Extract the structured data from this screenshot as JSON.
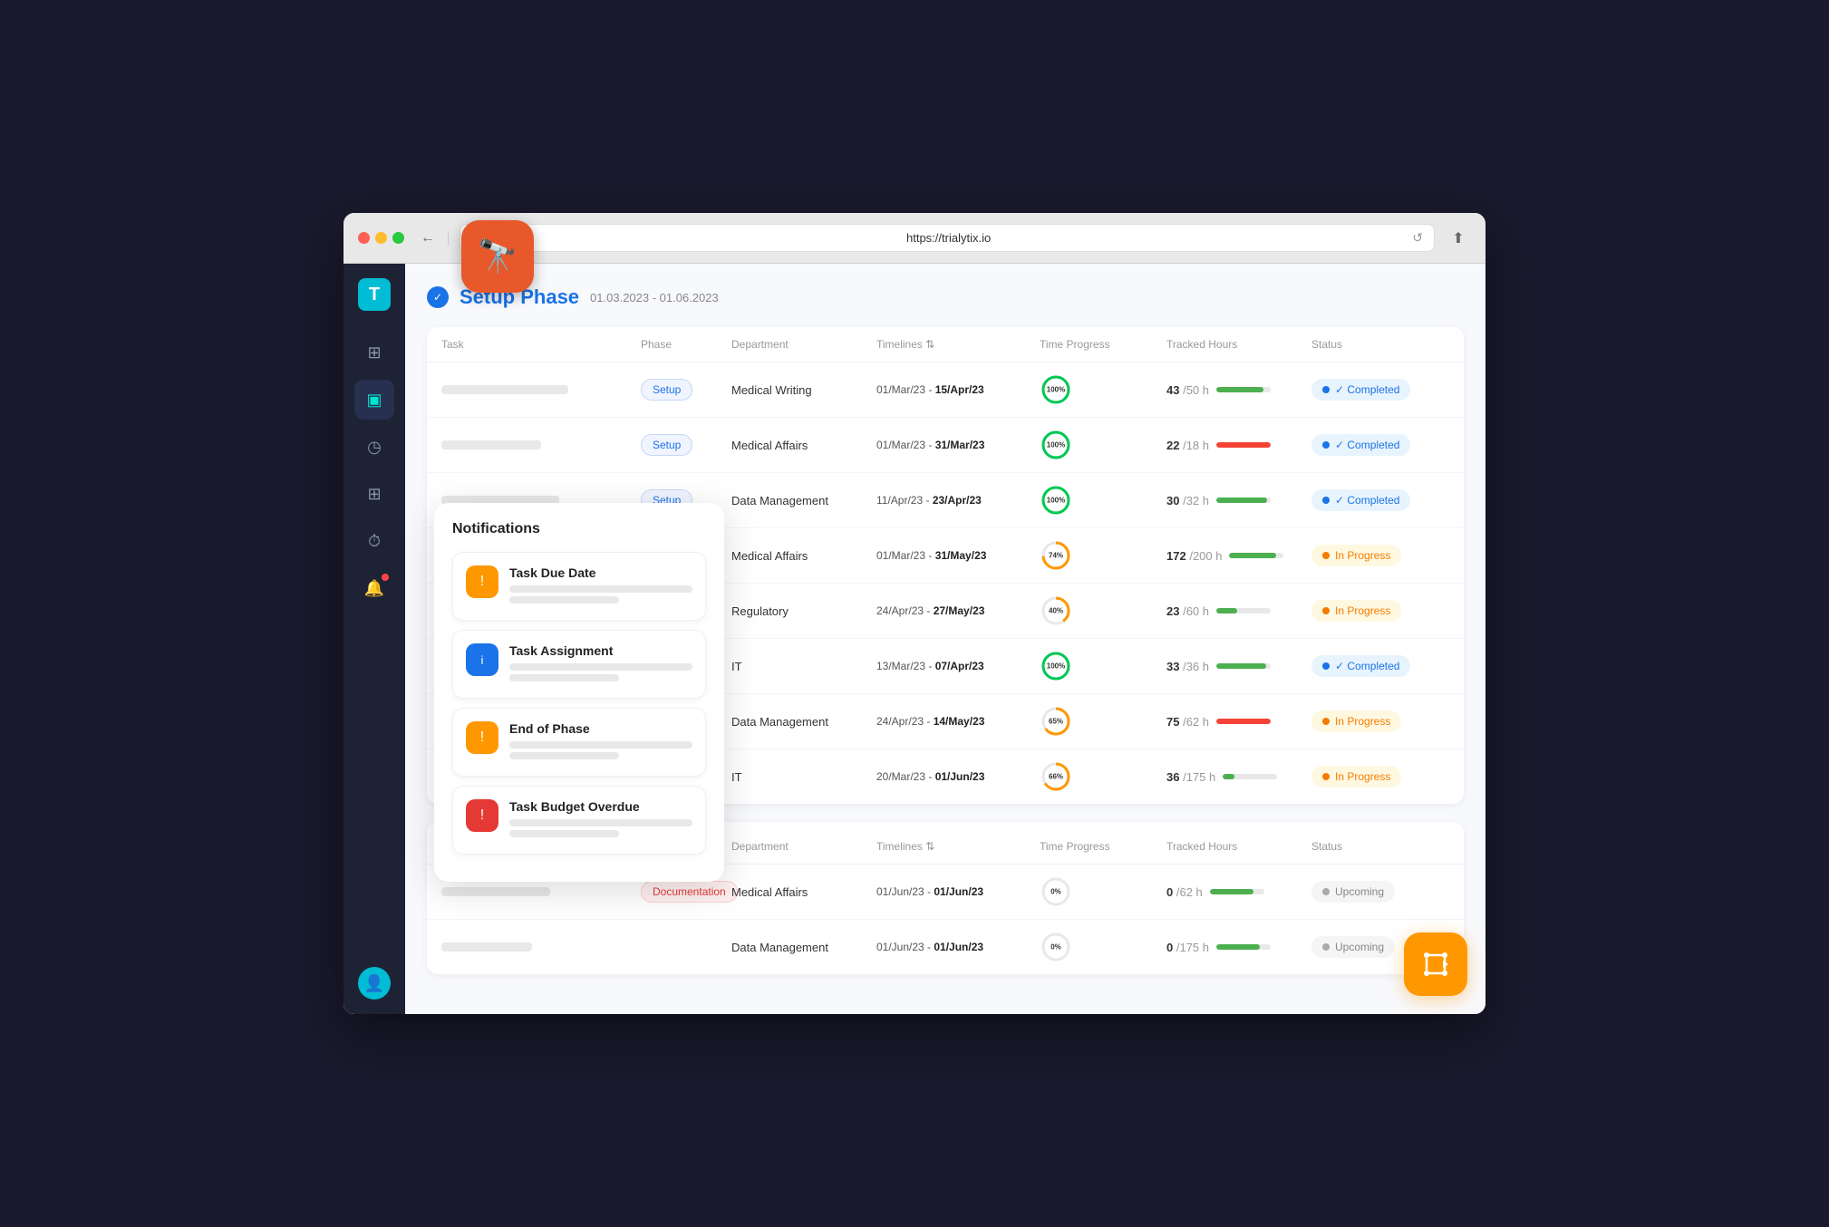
{
  "browser": {
    "url": "https://trialytix.io",
    "back_btn": "←",
    "refresh_btn": "↺",
    "share_btn": "⬆"
  },
  "sidebar": {
    "logo_letter": "T",
    "items": [
      {
        "id": "dashboard",
        "icon": "⊞",
        "active": false
      },
      {
        "id": "book",
        "icon": "▣",
        "active": true
      },
      {
        "id": "clock",
        "icon": "◷",
        "active": false
      },
      {
        "id": "grid-plus",
        "icon": "⊞",
        "active": false
      },
      {
        "id": "timer",
        "icon": "⏱",
        "active": false
      },
      {
        "id": "bell",
        "icon": "🔔",
        "active": false,
        "has_dot": true
      }
    ]
  },
  "page": {
    "phase1": {
      "title": "Setup Phase",
      "dates": "01.03.2023 - 01.06.2023",
      "columns": [
        "Task",
        "Phase",
        "Department",
        "Timelines ⇅",
        "Time Progress",
        "Tracked Hours",
        "Status"
      ],
      "rows": [
        {
          "has_placeholder": true,
          "phase_badge": "Setup",
          "phase_badge_type": "setup",
          "department": "Medical Writing",
          "timeline": "01/Mar/23",
          "timeline_end": "15/Apr/23",
          "progress_pct": 100,
          "progress_color": "#00c853",
          "hours_tracked": "43",
          "hours_total": "50 h",
          "bar_pct": 86,
          "bar_color": "green",
          "status": "Completed",
          "status_type": "completed"
        },
        {
          "has_placeholder": true,
          "phase_badge": "Setup",
          "phase_badge_type": "setup",
          "department": "Medical Affairs",
          "timeline": "01/Mar/23",
          "timeline_end": "31/Mar/23",
          "progress_pct": 100,
          "progress_color": "#00c853",
          "hours_tracked": "22",
          "hours_total": "18 h",
          "bar_pct": 100,
          "bar_color": "red",
          "status": "Completed",
          "status_type": "completed"
        },
        {
          "has_placeholder": true,
          "phase_badge": "Setup",
          "phase_badge_type": "setup",
          "department": "Data Management",
          "timeline": "11/Apr/23",
          "timeline_end": "23/Apr/23",
          "progress_pct": 100,
          "progress_color": "#00c853",
          "hours_tracked": "30",
          "hours_total": "32 h",
          "bar_pct": 94,
          "bar_color": "green",
          "status": "Completed",
          "status_type": "completed"
        },
        {
          "has_placeholder": false,
          "phase_badge": "",
          "phase_badge_type": "",
          "department": "Medical Affairs",
          "timeline": "01/Mar/23",
          "timeline_end": "31/May/23",
          "progress_pct": 74,
          "progress_color": "#ff9800",
          "hours_tracked": "172",
          "hours_total": "200 h",
          "bar_pct": 86,
          "bar_color": "green",
          "status": "In Progress",
          "status_type": "in-progress"
        },
        {
          "has_placeholder": false,
          "phase_badge": "",
          "phase_badge_type": "",
          "department": "Regulatory",
          "timeline": "24/Apr/23",
          "timeline_end": "27/May/23",
          "progress_pct": 40,
          "progress_color": "#ff9800",
          "hours_tracked": "23",
          "hours_total": "60 h",
          "bar_pct": 38,
          "bar_color": "green",
          "status": "In Progress",
          "status_type": "in-progress"
        },
        {
          "has_placeholder": false,
          "phase_badge": "",
          "phase_badge_type": "",
          "department": "IT",
          "timeline": "13/Mar/23",
          "timeline_end": "07/Apr/23",
          "progress_pct": 100,
          "progress_color": "#00c853",
          "hours_tracked": "33",
          "hours_total": "36 h",
          "bar_pct": 92,
          "bar_color": "green",
          "status": "Completed",
          "status_type": "completed"
        },
        {
          "has_placeholder": false,
          "phase_badge": "",
          "phase_badge_type": "",
          "department": "Data Management",
          "timeline": "24/Apr/23",
          "timeline_end": "14/May/23",
          "progress_pct": 65,
          "progress_color": "#ff9800",
          "hours_tracked": "75",
          "hours_total": "62 h",
          "bar_pct": 100,
          "bar_color": "red",
          "status": "In Progress",
          "status_type": "in-progress"
        },
        {
          "has_placeholder": false,
          "phase_badge": "",
          "phase_badge_type": "",
          "department": "IT",
          "timeline": "20/Mar/23",
          "timeline_end": "01/Jun/23",
          "progress_pct": 66,
          "progress_color": "#ff9800",
          "hours_tracked": "36",
          "hours_total": "175 h",
          "bar_pct": 21,
          "bar_color": "green",
          "status": "In Progress",
          "status_type": "in-progress"
        }
      ]
    },
    "phase2": {
      "columns": [
        "Department",
        "Timelines ⇅",
        "Time Progress",
        "Tracked Hours",
        "Status"
      ],
      "rows": [
        {
          "has_placeholder": true,
          "phase_badge": "Documentation",
          "phase_badge_type": "documentation",
          "department": "Medical Affairs",
          "timeline": "01/Jun/23",
          "timeline_end": "01/Jun/23",
          "progress_pct": 0,
          "progress_color": "#ccc",
          "hours_tracked": "0",
          "hours_total": "62 h",
          "bar_pct": 80,
          "bar_color": "green",
          "status": "Upcoming",
          "status_type": "upcoming"
        },
        {
          "has_placeholder": true,
          "phase_badge": "",
          "phase_badge_type": "",
          "department": "Data Management",
          "timeline": "01/Jun/23",
          "timeline_end": "01/Jun/23",
          "progress_pct": 0,
          "progress_color": "#ccc",
          "hours_tracked": "0",
          "hours_total": "175 h",
          "bar_pct": 80,
          "bar_color": "green",
          "status": "Upcoming",
          "status_type": "upcoming"
        }
      ]
    }
  },
  "notifications": {
    "title": "Notifications",
    "items": [
      {
        "name": "Task Due Date",
        "icon": "!",
        "icon_type": "orange"
      },
      {
        "name": "Task Assignment",
        "icon": "ⓘ",
        "icon_type": "blue"
      },
      {
        "name": "End of Phase",
        "icon": "!",
        "icon_type": "orange"
      },
      {
        "name": "Task Budget Overdue",
        "icon": "!",
        "icon_type": "red"
      }
    ]
  }
}
